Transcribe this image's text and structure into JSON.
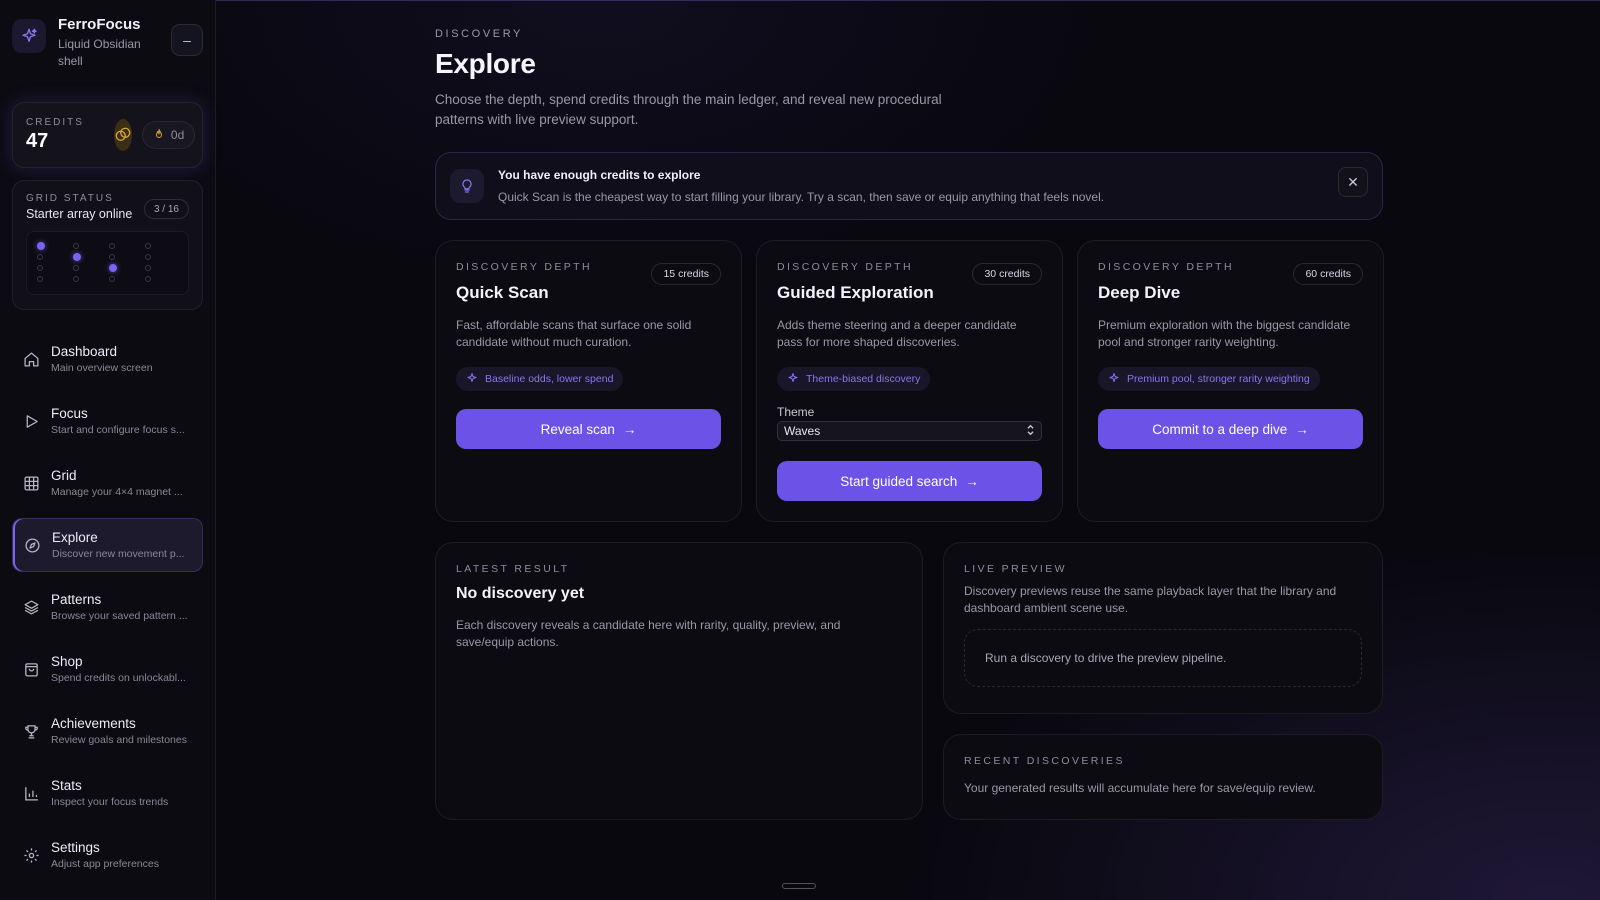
{
  "app": {
    "name": "FerroFocus",
    "subtitle": "Liquid Obsidian shell",
    "collapse_label": "–"
  },
  "credits": {
    "label": "CREDITS",
    "value": "47",
    "streak": "0d"
  },
  "grid_status": {
    "label": "GRID STATUS",
    "title": "Starter array online",
    "count": "3 / 16",
    "active_cells": [
      0,
      5,
      10
    ]
  },
  "nav": {
    "items": [
      {
        "label": "Dashboard",
        "desc": "Main overview screen",
        "icon": "home-icon"
      },
      {
        "label": "Focus",
        "desc": "Start and configure focus s...",
        "icon": "play-icon"
      },
      {
        "label": "Grid",
        "desc": "Manage your 4×4 magnet ...",
        "icon": "grid-icon"
      },
      {
        "label": "Explore",
        "desc": "Discover new movement p...",
        "icon": "compass-icon"
      },
      {
        "label": "Patterns",
        "desc": "Browse your saved pattern ...",
        "icon": "layers-icon"
      },
      {
        "label": "Shop",
        "desc": "Spend credits on unlockabl...",
        "icon": "bag-icon"
      },
      {
        "label": "Achievements",
        "desc": "Review goals and milestones",
        "icon": "trophy-icon"
      },
      {
        "label": "Stats",
        "desc": "Inspect your focus trends",
        "icon": "bar-chart-icon"
      },
      {
        "label": "Settings",
        "desc": "Adjust app preferences",
        "icon": "gear-icon"
      }
    ],
    "active_index": 3
  },
  "header": {
    "eyebrow": "DISCOVERY",
    "title": "Explore",
    "description": "Choose the depth, spend credits through the main ledger, and reveal new procedural patterns with live preview support."
  },
  "notice": {
    "title": "You have enough credits to explore",
    "body": "Quick Scan is the cheapest way to start filling your library. Try a scan, then save or equip anything that feels novel."
  },
  "depths": [
    {
      "eyebrow": "DISCOVERY DEPTH",
      "cost": "15 credits",
      "title": "Quick Scan",
      "desc": "Fast, affordable scans that surface one solid candidate without much curation.",
      "tag": "Baseline odds, lower spend",
      "cta": "Reveal scan"
    },
    {
      "eyebrow": "DISCOVERY DEPTH",
      "cost": "30 credits",
      "title": "Guided Exploration",
      "desc": "Adds theme steering and a deeper candidate pass for more shaped discoveries.",
      "tag": "Theme-biased discovery",
      "theme_label": "Theme",
      "theme_value": "Waves",
      "cta": "Start guided search"
    },
    {
      "eyebrow": "DISCOVERY DEPTH",
      "cost": "60 credits",
      "title": "Deep Dive",
      "desc": "Premium exploration with the biggest candidate pool and stronger rarity weighting.",
      "tag": "Premium pool, stronger rarity weighting",
      "cta": "Commit to a deep dive"
    }
  ],
  "latest": {
    "eyebrow": "LATEST RESULT",
    "title": "No discovery yet",
    "desc": "Each discovery reveals a candidate here with rarity, quality, preview, and save/equip actions."
  },
  "preview": {
    "eyebrow": "LIVE PREVIEW",
    "desc": "Discovery previews reuse the same playback layer that the library and dashboard ambient scene use.",
    "empty": "Run a discovery to drive the preview pipeline."
  },
  "recent": {
    "eyebrow": "RECENT DISCOVERIES",
    "desc": "Your generated results will accumulate here for save/equip review."
  }
}
